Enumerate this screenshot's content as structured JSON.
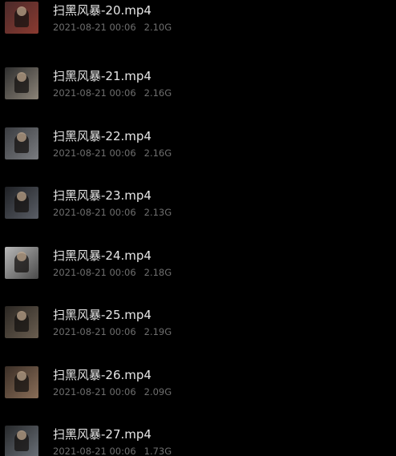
{
  "files": [
    {
      "name": "扫黑风暴-20.mp4",
      "date": "2021-08-21 00:06",
      "size": "2.10G",
      "thumb_icon": "video-thumbnail-icon",
      "thumb_color": "#4a2a2a",
      "thumb_color2": "#8a3a30"
    },
    {
      "name": "扫黑风暴-21.mp4",
      "date": "2021-08-21 00:06",
      "size": "2.16G",
      "thumb_icon": "video-thumbnail-icon",
      "thumb_color": "#2e2e2e",
      "thumb_color2": "#8c8478"
    },
    {
      "name": "扫黑风暴-22.mp4",
      "date": "2021-08-21 00:06",
      "size": "2.16G",
      "thumb_icon": "video-thumbnail-icon",
      "thumb_color": "#3a3c40",
      "thumb_color2": "#7a7c80"
    },
    {
      "name": "扫黑风暴-23.mp4",
      "date": "2021-08-21 00:06",
      "size": "2.13G",
      "thumb_icon": "video-thumbnail-icon",
      "thumb_color": "#1e2024",
      "thumb_color2": "#5a5e66"
    },
    {
      "name": "扫黑风暴-24.mp4",
      "date": "2021-08-21 00:06",
      "size": "2.18G",
      "thumb_icon": "video-thumbnail-icon",
      "thumb_color": "#b8b8b8",
      "thumb_color2": "#4a4a4a"
    },
    {
      "name": "扫黑风暴-25.mp4",
      "date": "2021-08-21 00:06",
      "size": "2.19G",
      "thumb_icon": "video-thumbnail-icon",
      "thumb_color": "#2a2622",
      "thumb_color2": "#6a5e50"
    },
    {
      "name": "扫黑风暴-26.mp4",
      "date": "2021-08-21 00:06",
      "size": "2.09G",
      "thumb_icon": "video-thumbnail-icon",
      "thumb_color": "#3a2e26",
      "thumb_color2": "#8a6e58"
    },
    {
      "name": "扫黑风暴-27.mp4",
      "date": "2021-08-21 00:06",
      "size": "1.73G",
      "thumb_icon": "video-thumbnail-icon",
      "thumb_color": "#26282a",
      "thumb_color2": "#6a7078"
    }
  ]
}
